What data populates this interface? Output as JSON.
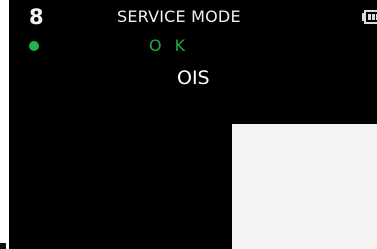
{
  "header": {
    "mode_number": "8",
    "title": "SERVICE MODE",
    "battery_icon": "battery-icon"
  },
  "status": {
    "indicator_color": "#22b14c",
    "text": "O K",
    "text_color": "#1fa845"
  },
  "test": {
    "name": "OIS"
  },
  "colors": {
    "screen_background": "#000000",
    "text": "#ffffff",
    "patch": "#f4f3f1"
  }
}
